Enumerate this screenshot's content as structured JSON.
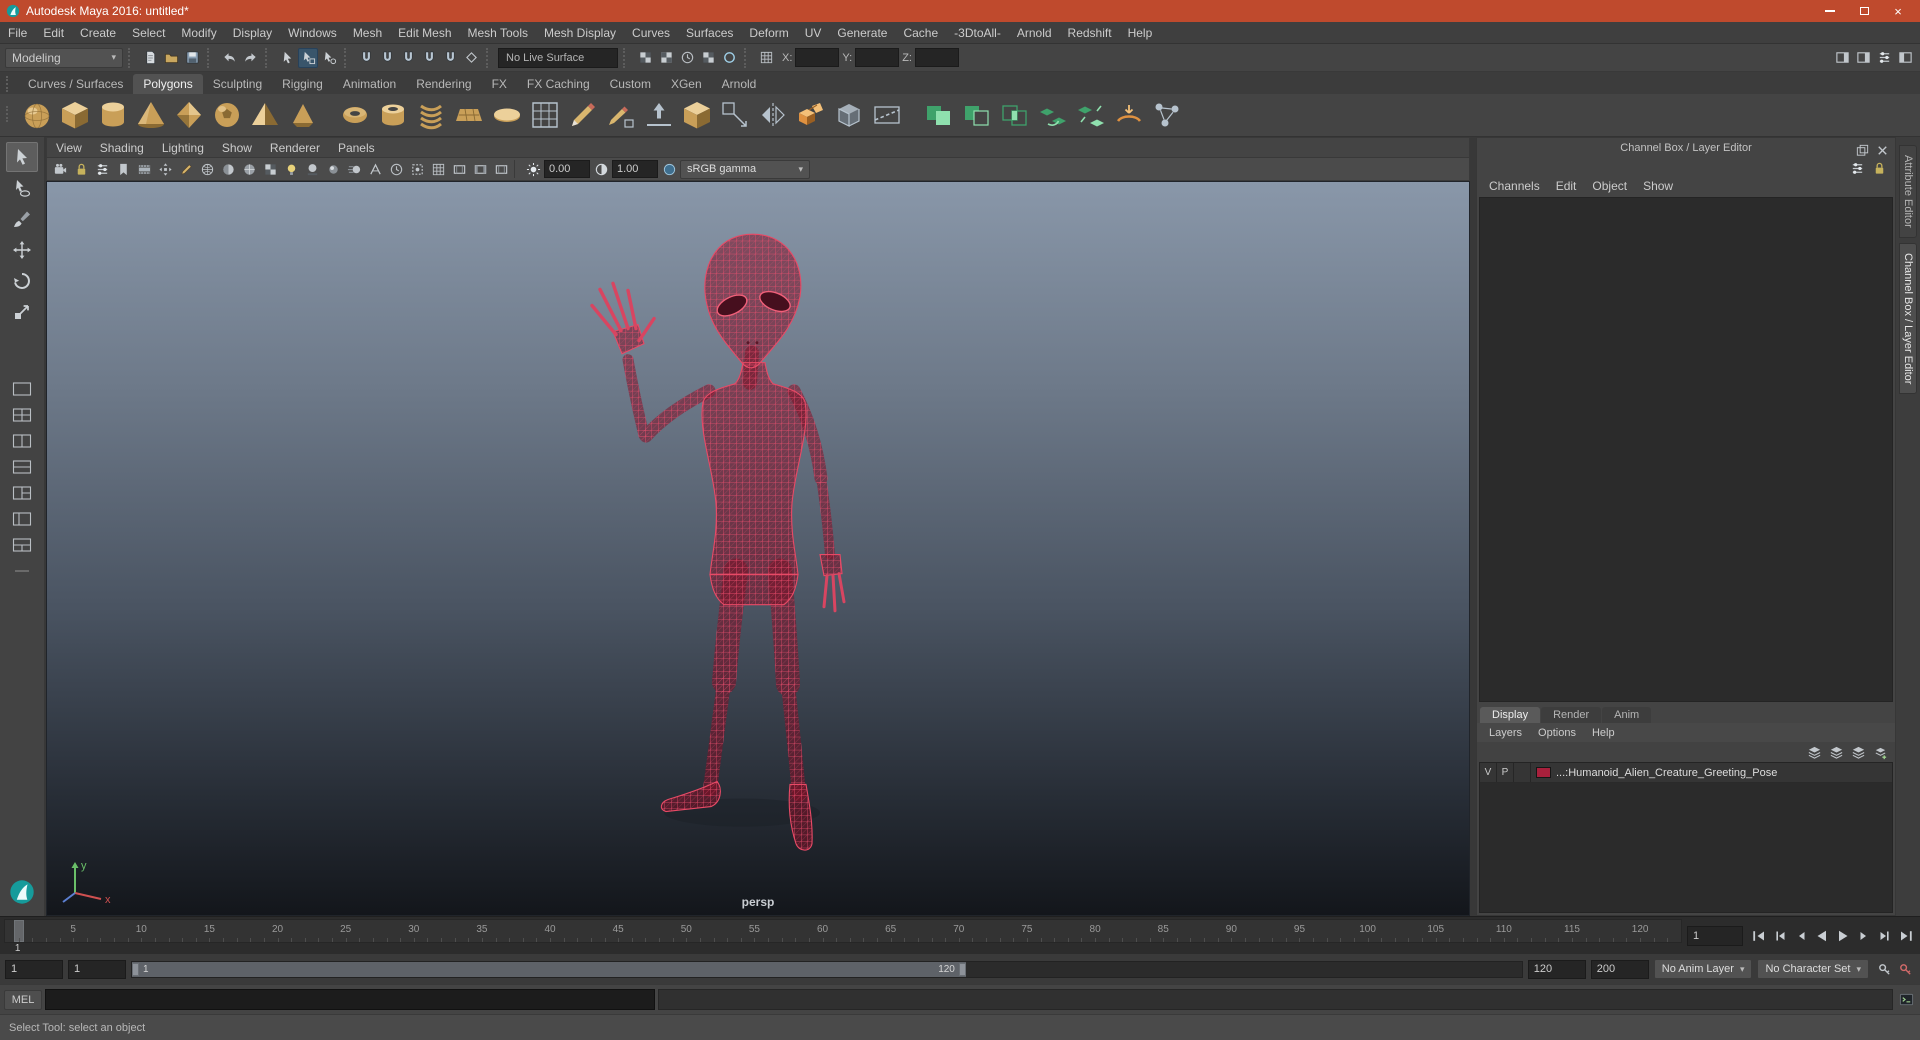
{
  "window": {
    "title": "Autodesk Maya 2016: untitled*",
    "controls": [
      "minimize",
      "maximize",
      "close"
    ]
  },
  "menu_bar": [
    "File",
    "Edit",
    "Create",
    "Select",
    "Modify",
    "Display",
    "Windows",
    "Mesh",
    "Edit Mesh",
    "Mesh Tools",
    "Mesh Display",
    "Curves",
    "Surfaces",
    "Deform",
    "UV",
    "Generate",
    "Cache",
    "-3DtoAll-",
    "Arnold",
    "Redshift",
    "Help"
  ],
  "status_line": {
    "mode": "Modeling",
    "file_group": [
      "new-scene",
      "open-scene",
      "save-scene"
    ],
    "undo_group": [
      "undo",
      "redo"
    ],
    "select_group": [
      "select-by-hierarchy",
      "select-by-object",
      "select-by-component"
    ],
    "select_active": "select-by-object",
    "snap_group": [
      "snap-to-grids",
      "snap-to-curves",
      "snap-to-points",
      "snap-to-projected-center",
      "snap-to-view-planes",
      "make-live"
    ],
    "live_surface": "No Live Surface",
    "history_group": [
      "input-connections",
      "output-connections",
      "construction-history",
      "texture-placement",
      "highlight-selection"
    ],
    "symmetry_group": [
      "symmetry-off"
    ],
    "coord_labels": {
      "x": "X:",
      "y": "Y:",
      "z": "Z:"
    },
    "coord_values": {
      "x": "",
      "y": "",
      "z": ""
    },
    "toggle_group": [
      "modeling-toolkit",
      "attribute-editor",
      "tool-settings",
      "channel-box"
    ]
  },
  "shelf": {
    "tabs": [
      "Curves / Surfaces",
      "Polygons",
      "Sculpting",
      "Rigging",
      "Animation",
      "Rendering",
      "FX",
      "FX Caching",
      "Custom",
      "XGen",
      "Arnold"
    ],
    "active_tab": "Polygons",
    "icons": [
      {
        "name": "poly-sphere",
        "shape": "sphere",
        "color": "gold"
      },
      {
        "name": "poly-cube",
        "shape": "cube",
        "color": "gold"
      },
      {
        "name": "poly-cylinder",
        "shape": "cylinder",
        "color": "gold"
      },
      {
        "name": "poly-cone",
        "shape": "cone",
        "color": "gold"
      },
      {
        "name": "poly-platonic",
        "shape": "diamond",
        "color": "gold"
      },
      {
        "name": "poly-soccer-ball",
        "shape": "soccer",
        "color": "gold"
      },
      {
        "name": "poly-pyramid",
        "shape": "pyramid",
        "color": "gold"
      },
      {
        "name": "poly-prism",
        "shape": "prism",
        "color": "gold"
      },
      {
        "name": "poly-torus",
        "shape": "torus",
        "color": "gold",
        "gap_before": true
      },
      {
        "name": "poly-pipe",
        "shape": "pipe",
        "color": "gold"
      },
      {
        "name": "poly-helix",
        "shape": "helix",
        "color": "gold"
      },
      {
        "name": "poly-plane",
        "shape": "plane",
        "color": "gold"
      },
      {
        "name": "poly-disc",
        "shape": "disc",
        "color": "gold"
      },
      {
        "name": "poly-grid",
        "shape": "grid",
        "color": "steel"
      },
      {
        "name": "create-polygon-tool",
        "shape": "pencil",
        "color": "steel"
      },
      {
        "name": "quad-draw-tool",
        "shape": "pencil2",
        "color": "steel"
      },
      {
        "name": "sculpt-tool",
        "shape": "sculpt",
        "color": "steel"
      },
      {
        "name": "smooth",
        "shape": "cube",
        "color": "gold"
      },
      {
        "name": "target-weld",
        "shape": "weld",
        "color": "steel"
      },
      {
        "name": "mirror",
        "shape": "mirror",
        "color": "steel"
      },
      {
        "name": "extrude",
        "shape": "extrude",
        "color": "orange"
      },
      {
        "name": "bevel",
        "shape": "bevelx",
        "color": "steel"
      },
      {
        "name": "multi-cut",
        "shape": "pluscut",
        "color": "steel"
      },
      {
        "name": "boolean-union",
        "shape": "boolcube",
        "color": "green",
        "gap_before": true
      },
      {
        "name": "boolean-difference",
        "shape": "boolcube2",
        "color": "green"
      },
      {
        "name": "boolean-intersection",
        "shape": "boolcube3",
        "color": "green"
      },
      {
        "name": "combine",
        "shape": "combine",
        "color": "green"
      },
      {
        "name": "separate",
        "shape": "separate",
        "color": "green"
      },
      {
        "name": "conform",
        "shape": "conform",
        "color": "orange"
      },
      {
        "name": "node-editor",
        "shape": "network",
        "color": "steel"
      }
    ]
  },
  "toolbox": {
    "tools": [
      "select-tool",
      "lasso-tool",
      "paint-selection-tool",
      "move-tool",
      "rotate-tool",
      "scale-tool"
    ],
    "active_tool": "select-tool",
    "layouts": [
      "single-pane-layout",
      "four-pane-layout",
      "two-pane-side-layout",
      "two-pane-stacked-layout",
      "three-pane-layout",
      "outliner-persp-layout",
      "custom-layout"
    ]
  },
  "viewport": {
    "menus": [
      "View",
      "Shading",
      "Lighting",
      "Show",
      "Renderer",
      "Panels"
    ],
    "toolbar_icons": [
      "select-camera",
      "lock-camera",
      "camera-attributes",
      "bookmarks",
      "image-plane",
      "two-d-pan-zoom",
      "grease-pencil",
      "wireframe",
      "smooth-shade",
      "wireframe-on-shaded",
      "textured",
      "use-all-lights",
      "shadows",
      "screen-space-ao",
      "motion-blur",
      "multisample-aa",
      "sequence-time",
      "isolate-select",
      "field-chart",
      "resolution-gate",
      "gate-mask",
      "safe-action"
    ],
    "exposure": "0.00",
    "gamma": "1.00",
    "view_transform": "sRGB gamma",
    "camera_label": "persp",
    "axis": {
      "x": "x",
      "y": "y"
    }
  },
  "channel_box": {
    "title": "Channel Box / Layer Editor",
    "header_icons": [
      "float-panel",
      "close-panel"
    ],
    "tool_icons": [
      "channel-manipulators",
      "channel-settings"
    ],
    "menus": [
      "Channels",
      "Edit",
      "Object",
      "Show"
    ],
    "layer_tabs": [
      "Display",
      "Render",
      "Anim"
    ],
    "active_layer_tab": "Display",
    "layer_menus": [
      "Layers",
      "Options",
      "Help"
    ],
    "layer_icons": [
      "layer-moveup",
      "layer-movedown",
      "new-empty-layer",
      "new-layer-from-selected"
    ],
    "layers": [
      {
        "visible": "V",
        "playback": "P",
        "color": "#a8203c",
        "name": "...:Humanoid_Alien_Creature_Greeting_Pose"
      }
    ]
  },
  "edge_tabs": [
    {
      "label": "Attribute Editor",
      "active": false
    },
    {
      "label": "Channel Box / Layer Editor",
      "active": true
    }
  ],
  "timeline": {
    "ticks": [
      5,
      10,
      15,
      20,
      25,
      30,
      35,
      40,
      45,
      50,
      55,
      60,
      65,
      70,
      75,
      80,
      85,
      90,
      95,
      100,
      105,
      110,
      115,
      120
    ],
    "playhead_frame": 1,
    "playhead_label": "1",
    "current_frame": "1",
    "transport": [
      "go-to-start",
      "step-back-one-key",
      "step-back-one-frame",
      "play-backwards",
      "play-forwards",
      "step-forward-one-frame",
      "step-forward-one-key",
      "go-to-end"
    ]
  },
  "range_slider": {
    "animation_start": "1",
    "playback_start": "1",
    "range_start_label": "1",
    "range_end_label": "120",
    "playback_end": "120",
    "animation_end": "200",
    "anim_layer": "No Anim Layer",
    "character_set": "No Character Set",
    "icons": [
      "character-set-menu",
      "auto-keyframe"
    ]
  },
  "command_line": {
    "label": "MEL",
    "input_value": "",
    "icons": [
      "script-editor"
    ]
  },
  "help_line": {
    "text": "Select Tool: select an object"
  },
  "colors": {
    "titlebar": "#bf4a2d",
    "accent_blue": "#39556b",
    "wireframe_red": "#d93252",
    "layer_swatch": "#a8203c"
  }
}
